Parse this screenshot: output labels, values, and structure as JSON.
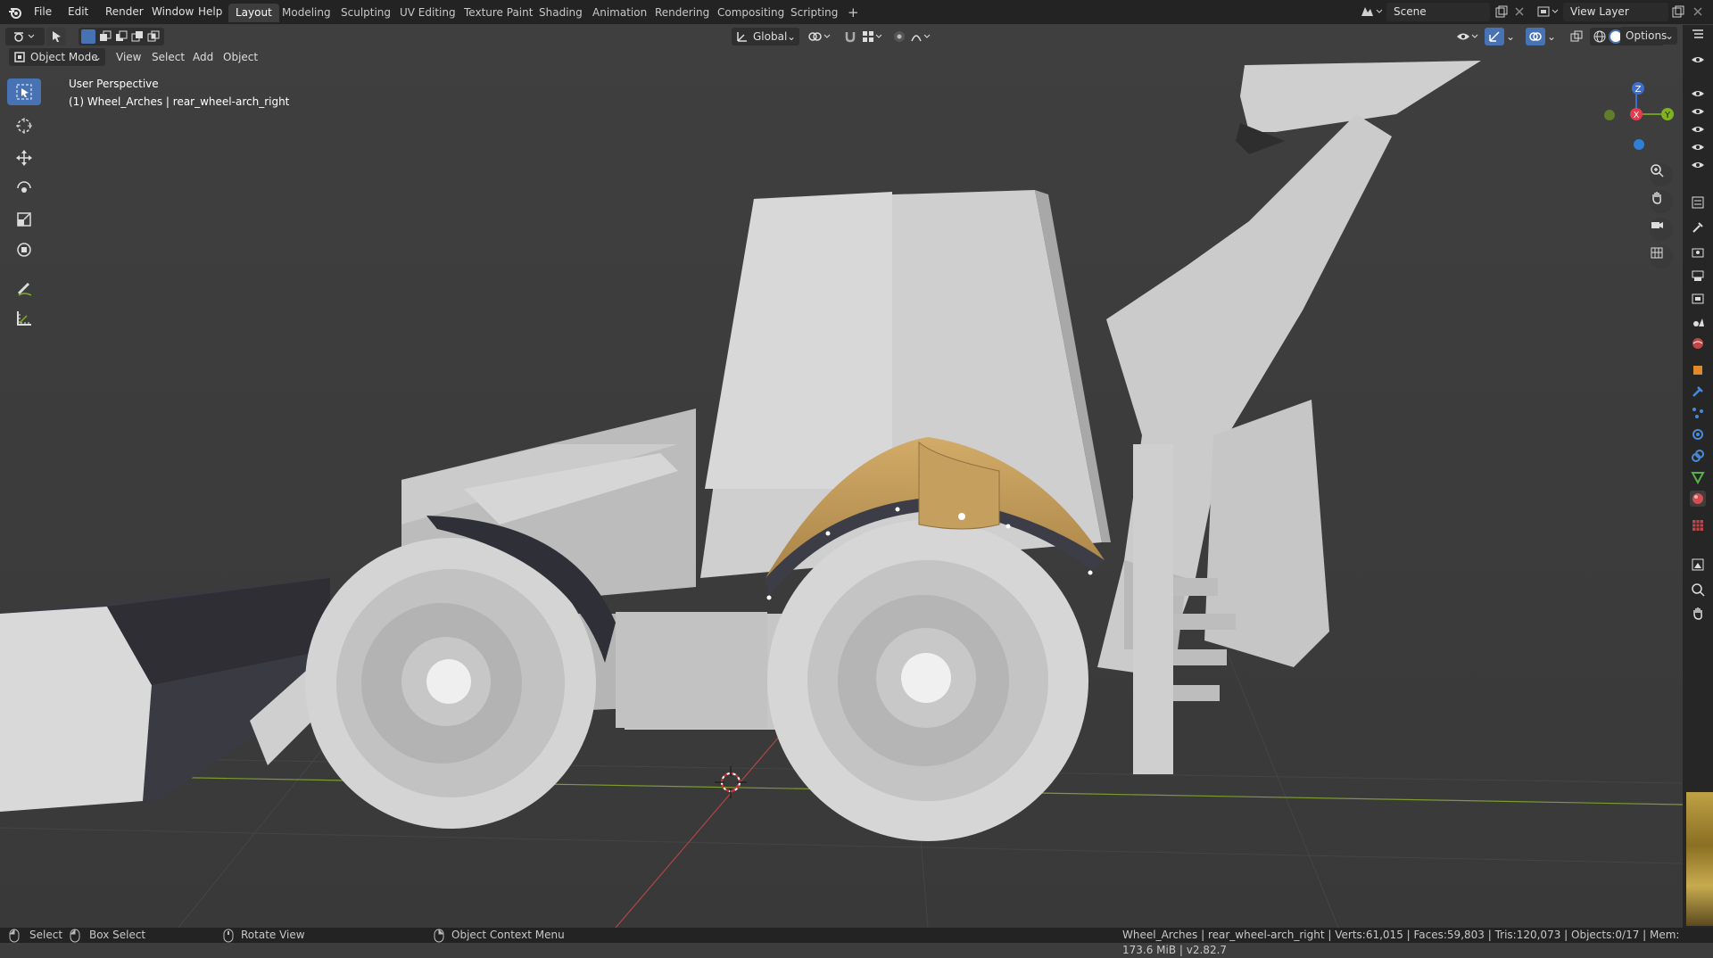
{
  "menu": [
    "File",
    "Edit",
    "Render",
    "Window",
    "Help"
  ],
  "workspaces": [
    "Layout",
    "Modeling",
    "Sculpting",
    "UV Editing",
    "Texture Paint",
    "Shading",
    "Animation",
    "Rendering",
    "Compositing",
    "Scripting"
  ],
  "active_workspace": "Layout",
  "add_workspace": "+",
  "scene": {
    "label": "Scene"
  },
  "view_layer": {
    "label": "View Layer"
  },
  "viewport_header": {
    "mode": "Object Mode",
    "menus": [
      "View",
      "Select",
      "Add",
      "Object"
    ],
    "orientation": "Global",
    "options": "Options"
  },
  "viewport": {
    "perspective": "User Perspective",
    "object_info": "(1) Wheel_Arches | rear_wheel-arch_right",
    "gizmo": {
      "z": "Z",
      "x": "X",
      "y": "Y"
    }
  },
  "colors": {
    "accent": "#4772b3",
    "grid_x": "#b04545",
    "grid_y": "#7d9a33",
    "arch_gold": "#c7a160",
    "arch_dark": "#3d3d48"
  },
  "statusbar": {
    "select": "Select",
    "box_select": "Box Select",
    "rotate_view": "Rotate View",
    "context_menu": "Object Context Menu",
    "stats": "Wheel_Arches | rear_wheel-arch_right | Verts:61,015 | Faces:59,803 | Tris:120,073 | Objects:0/17 | Mem: 173.6 MiB | v2.82.7"
  }
}
